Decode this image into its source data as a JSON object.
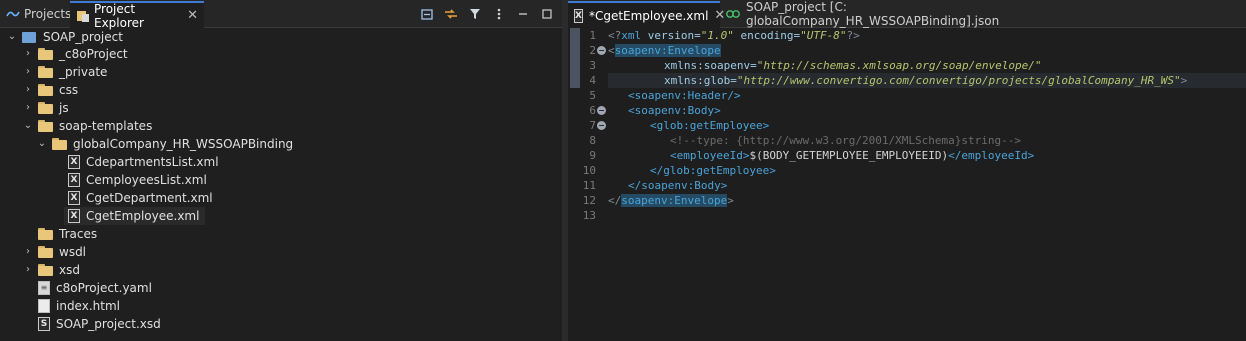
{
  "left_panel": {
    "tabs": [
      {
        "label": "Projects"
      },
      {
        "label": "Project Explorer",
        "close": "✕"
      }
    ],
    "tree": [
      {
        "label": "SOAP_project",
        "expanded": true,
        "kind": "project"
      },
      {
        "label": "_c8oProject",
        "kind": "folder"
      },
      {
        "label": "_private",
        "kind": "folder"
      },
      {
        "label": "css",
        "kind": "folder"
      },
      {
        "label": "js",
        "kind": "folder"
      },
      {
        "label": "soap-templates",
        "kind": "folder"
      },
      {
        "label": "globalCompany_HR_WSSOAPBinding",
        "kind": "folder"
      },
      {
        "label": "CdepartmentsList.xml",
        "kind": "xml"
      },
      {
        "label": "CemployeesList.xml",
        "kind": "xml"
      },
      {
        "label": "CgetDepartment.xml",
        "kind": "xml"
      },
      {
        "label": "CgetEmployee.xml",
        "kind": "xml",
        "selected": true
      },
      {
        "label": "Traces",
        "kind": "folder"
      },
      {
        "label": "wsdl",
        "kind": "folder"
      },
      {
        "label": "xsd",
        "kind": "folder"
      },
      {
        "label": "c8oProject.yaml",
        "kind": "yaml"
      },
      {
        "label": "index.html",
        "kind": "html"
      },
      {
        "label": "SOAP_project.xsd",
        "kind": "xsd"
      }
    ]
  },
  "editor": {
    "tabs": [
      {
        "label": "*CgetEmployee.xml",
        "close": "✕"
      },
      {
        "label": "SOAP_project [C: globalCompany_HR_WSSOAPBinding].json"
      }
    ],
    "line_numbers": [
      "1",
      "2",
      "3",
      "4",
      "5",
      "6",
      "7",
      "8",
      "9",
      "10",
      "11",
      "12",
      "13"
    ],
    "code": {
      "l1_open": "<?",
      "l1_xml": "xml",
      "l1_version_attr": " version=",
      "l1_version_val": "\"1.0\"",
      "l1_enc_attr": " encoding=",
      "l1_enc_val": "\"UTF-8\"",
      "l1_close": "?>",
      "l2_lt": "<",
      "l2_tag": "soapenv:Envelope",
      "l3_attr": "xmlns:soapenv=",
      "l3_val": "\"http://schemas.xmlsoap.org/soap/envelope/\"",
      "l4_attr": "xmlns:glob=",
      "l4_val": "\"http://www.convertigo.com/convertigo/projects/globalCompany_HR_WS\"",
      "l4_gt": ">",
      "l5": "<soapenv:Header/>",
      "l6": "<soapenv:Body>",
      "l7": "<glob:getEmployee>",
      "l8": "<!--type: {http://www.w3.org/2001/XMLSchema}string-->",
      "l9_open": "<employeeId>",
      "l9_text": "$(BODY_GETEMPLOYEE_EMPLOYEEID)",
      "l9_close": "</employeeId>",
      "l10": "</glob:getEmployee>",
      "l11": "</soapenv:Body>",
      "l12_lt": "</",
      "l12_tag": "soapenv:Envelope",
      "l12_gt": ">"
    }
  },
  "colors": {
    "accent": "#3d7bd5",
    "tag": "#4aa3d8",
    "string": "#b7c56f",
    "comment": "#6b6b6b"
  }
}
